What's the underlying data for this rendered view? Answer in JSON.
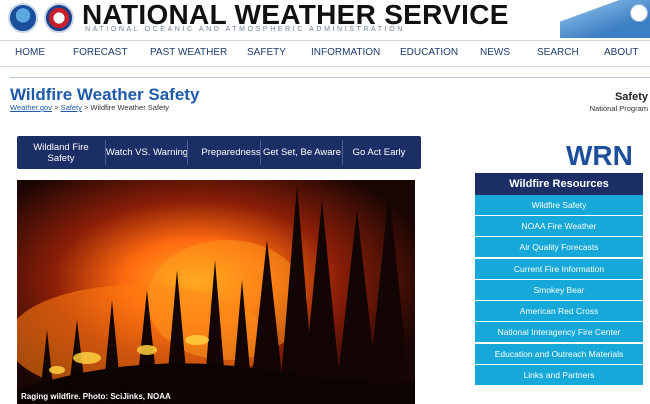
{
  "header": {
    "logo_noaa": "NOAA",
    "logo_nws": "NWS",
    "title": "NATIONAL WEATHER SERVICE",
    "subtitle": "NATIONAL OCEANIC AND ATMOSPHERIC ADMINISTRATION"
  },
  "nav": {
    "items": [
      "HOME",
      "FORECAST",
      "PAST WEATHER",
      "SAFETY",
      "INFORMATION",
      "EDUCATION",
      "NEWS",
      "SEARCH",
      "ABOUT"
    ]
  },
  "page": {
    "title": "Wildfire Weather Safety",
    "breadcrumb": [
      "Weather.gov",
      "Safety",
      "Wildfire Weather Safety"
    ],
    "breadcrumb_sep": ">",
    "side_heading": "Safety",
    "side_sub": "National Program"
  },
  "tabs": [
    "Wildland Fire Safety",
    "Watch VS. Warning",
    "Preparedness",
    "Get Set, Be Aware",
    "Go Act Early"
  ],
  "photo": {
    "caption": "Raging wildfire. Photo: SciJinks, NOAA"
  },
  "wrn_logo": "WRN",
  "resources": {
    "heading": "Wildfire Resources",
    "links": [
      "Wildfire Safety",
      "NOAA Fire Weather",
      "Air Quality Forecasts",
      "Current Fire Information",
      "Smokey Bear",
      "American Red Cross",
      "National Interagency Fire Center",
      "Education and Outreach Materials",
      "Links and Partners"
    ]
  }
}
